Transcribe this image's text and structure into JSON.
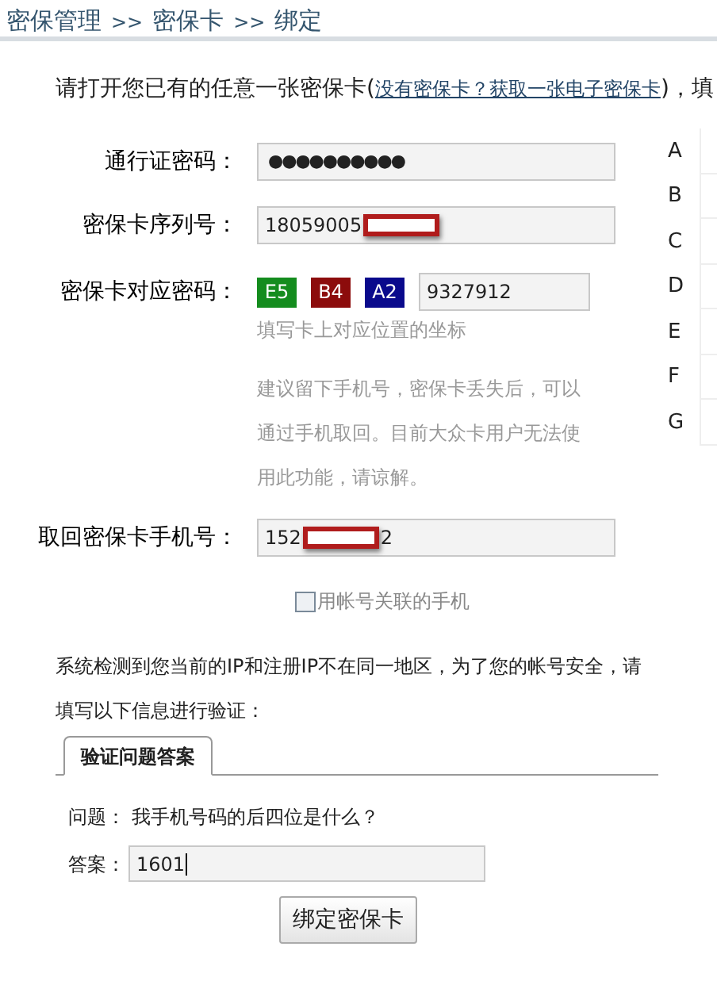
{
  "breadcrumb": [
    "密保管理",
    ">>",
    "密保卡",
    ">>",
    "绑定"
  ],
  "instruction": {
    "before": "请打开您已有的任意一张密保卡(",
    "link": "没有密保卡？获取一张电子密保卡",
    "after": ")，填"
  },
  "password": {
    "label": "通行证密码：",
    "value": "●●●●●●●●●●"
  },
  "serial": {
    "label": "密保卡序列号：",
    "value_before": "18059005",
    "redacted": true
  },
  "card_code": {
    "label": "密保卡对应密码：",
    "coords": [
      {
        "text": "E5",
        "color": "#148c1e"
      },
      {
        "text": "B4",
        "color": "#8c0c0c"
      },
      {
        "text": "A2",
        "color": "#0a0a8c"
      }
    ],
    "value": "9327912",
    "hint": "填写卡上对应位置的坐标"
  },
  "advice": "建议留下手机号，密保卡丢失后，可以通过手机取回。目前大众卡用户无法使用此功能，请谅解。",
  "phone": {
    "label": "取回密保卡手机号：",
    "value_before": "152",
    "redacted": true,
    "value_after": "2"
  },
  "use_account_phone": {
    "label": "用帐号关联的手机",
    "checked": false
  },
  "card_rows": [
    "A",
    "B",
    "C",
    "D",
    "E",
    "F",
    "G"
  ],
  "notice": "系统检测到您当前的IP和注册IP不在同一地区，为了您的帐号安全，请填写以下信息进行验证：",
  "tabs": [
    {
      "label": "验证问题答案",
      "selected": true
    }
  ],
  "question": {
    "label": "问题：",
    "text": "我手机号码的后四位是什么？"
  },
  "answer": {
    "label": "答案：",
    "value": "1601"
  },
  "submit": "绑定密保卡"
}
